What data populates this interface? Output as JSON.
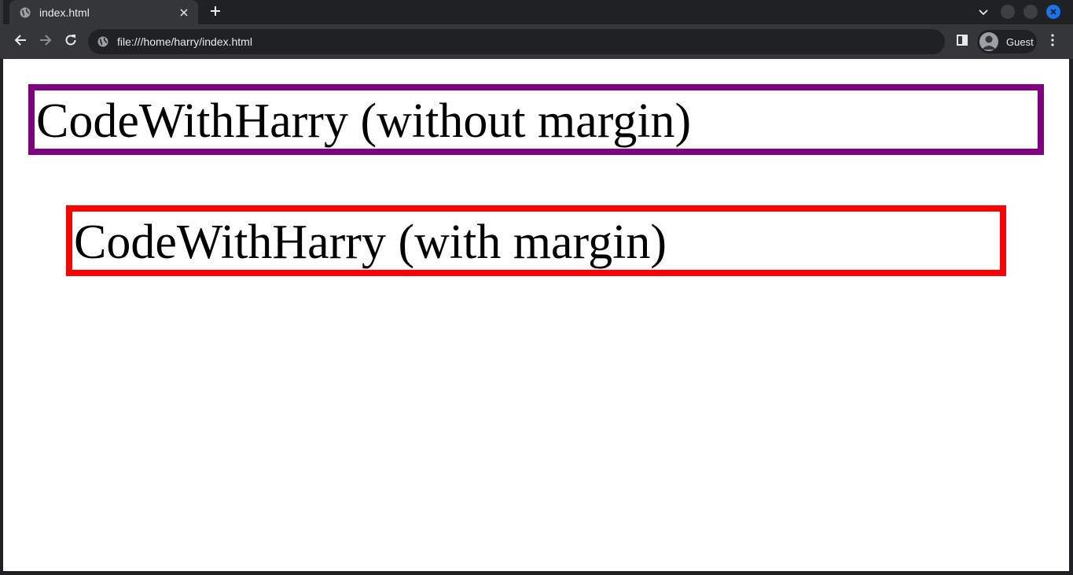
{
  "browser": {
    "tab": {
      "title": "index.html",
      "favicon": "globe-icon",
      "close": "close-icon"
    },
    "new_tab": "plus-icon",
    "address": {
      "url": "file:///home/harry/index.html",
      "icon": "globe-icon"
    },
    "profile": {
      "label": "Guest"
    },
    "colors": {
      "frame": "#202124",
      "toolbar": "#35363a",
      "text": "#e8eaed",
      "accent": "#1a73e8"
    }
  },
  "page": {
    "boxes": [
      {
        "text": "CodeWithHarry (without margin)",
        "border_color": "#800080"
      },
      {
        "text": "CodeWithHarry (with margin)",
        "border_color": "#ff0000"
      }
    ]
  }
}
